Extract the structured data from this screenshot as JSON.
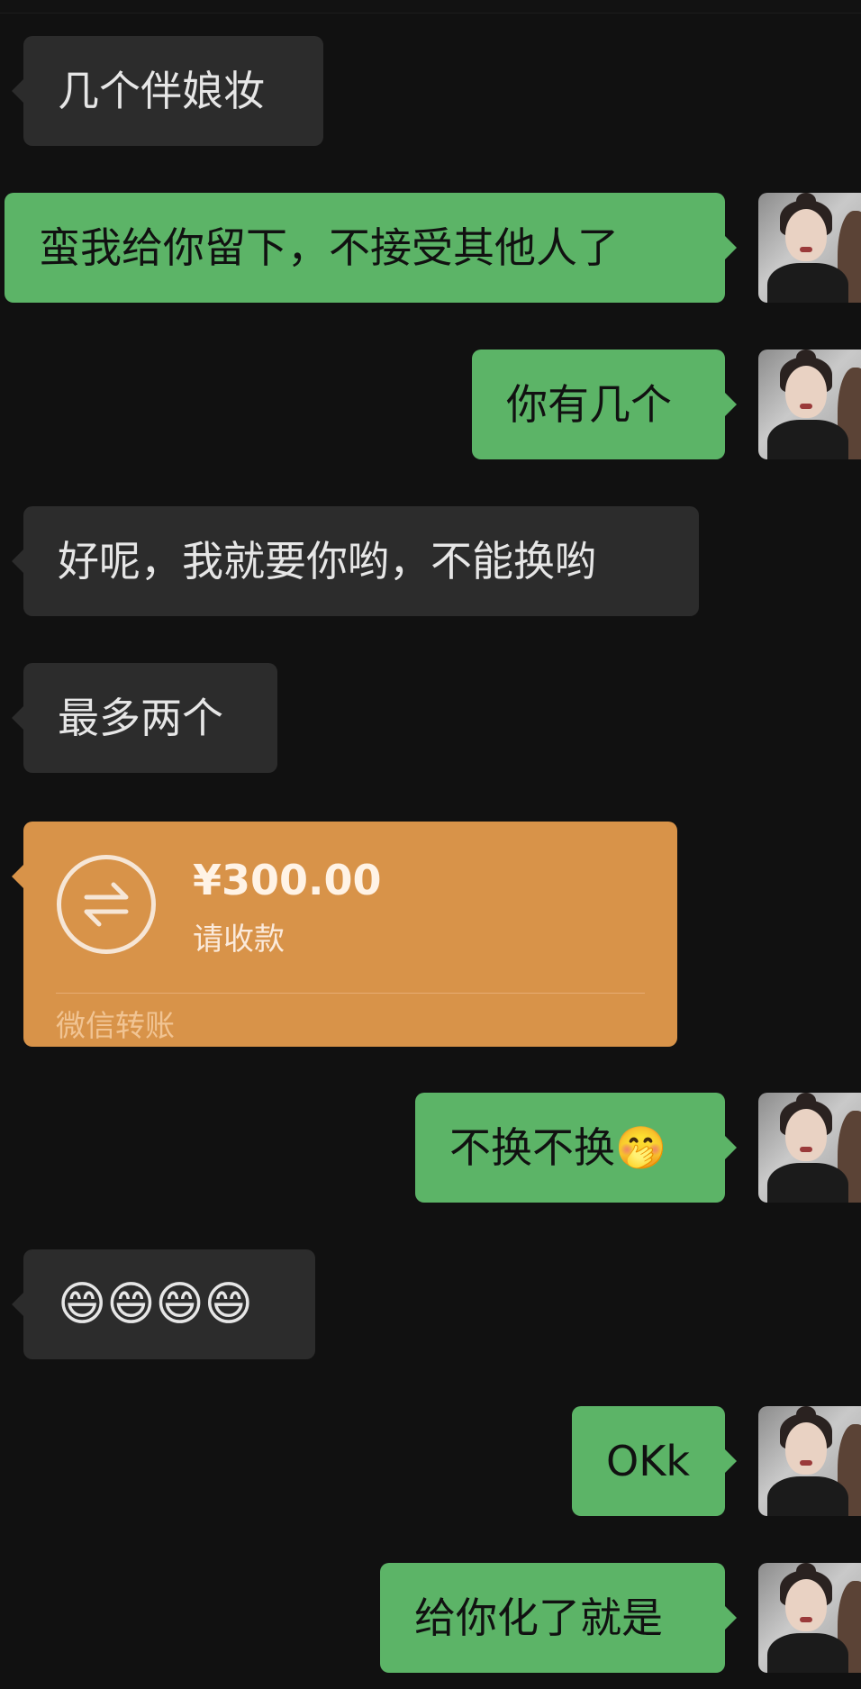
{
  "messages": {
    "m1": "几个伴娘妆",
    "m2": "蛮我给你留下，不接受其他人了",
    "m3": "你有几个",
    "m4": "好呢，我就要你哟，不能换哟",
    "m5": "最多两个",
    "m7": "不换不换🤭",
    "m8": "😄😄😄😄",
    "m9": "OKk",
    "m10": "给你化了就是"
  },
  "transfer": {
    "amount": "¥300.00",
    "subtitle": "请收款",
    "footer": "微信转账"
  },
  "colors": {
    "background": "#111111",
    "incoming_bubble": "#2c2c2c",
    "outgoing_bubble": "#5cb467",
    "transfer_card": "#d89349"
  }
}
